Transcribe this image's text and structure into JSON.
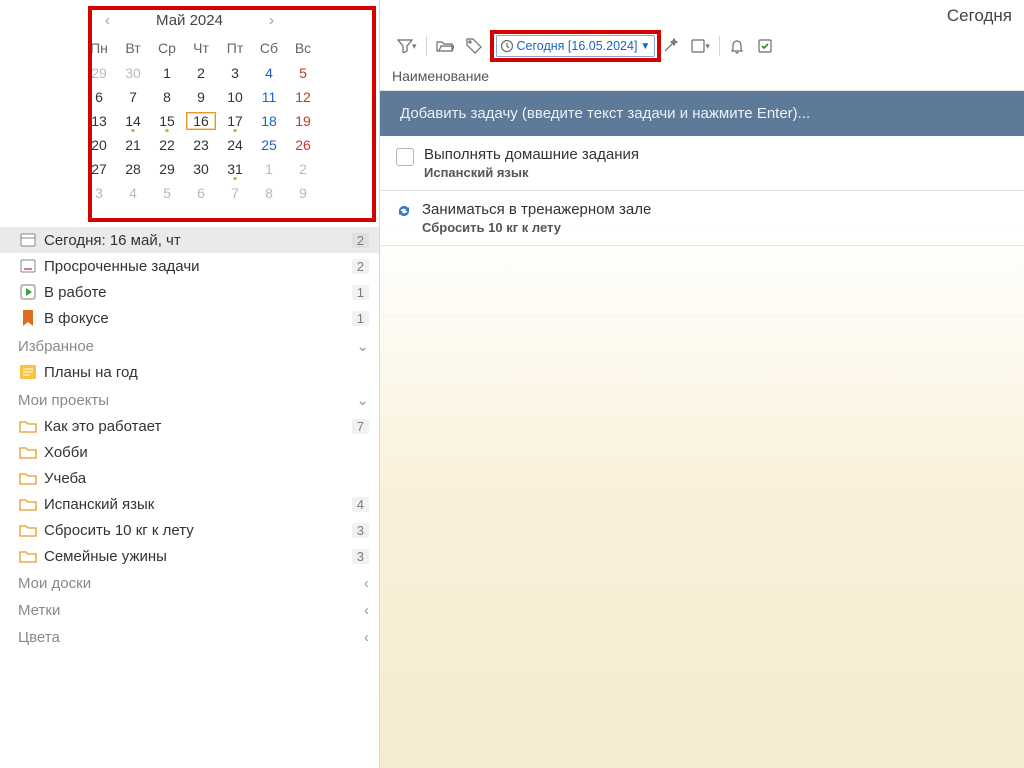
{
  "calendar": {
    "title": "Май 2024",
    "weekdays": [
      "Пн",
      "Вт",
      "Ср",
      "Чт",
      "Пт",
      "Сб",
      "Вс"
    ],
    "weeks": [
      [
        {
          "n": 29,
          "cls": "other"
        },
        {
          "n": 30,
          "cls": "other"
        },
        {
          "n": 1
        },
        {
          "n": 2
        },
        {
          "n": 3
        },
        {
          "n": 4,
          "cls": "sat"
        },
        {
          "n": 5,
          "cls": "sun"
        }
      ],
      [
        {
          "n": 6
        },
        {
          "n": 7
        },
        {
          "n": 8
        },
        {
          "n": 9
        },
        {
          "n": 10
        },
        {
          "n": 11,
          "cls": "sat"
        },
        {
          "n": 12,
          "cls": "sun"
        }
      ],
      [
        {
          "n": 13
        },
        {
          "n": 14,
          "dot": true
        },
        {
          "n": 15,
          "dot": true
        },
        {
          "n": 16,
          "today": true
        },
        {
          "n": 17,
          "dot": true
        },
        {
          "n": 18,
          "cls": "sat"
        },
        {
          "n": 19,
          "cls": "sun"
        }
      ],
      [
        {
          "n": 20
        },
        {
          "n": 21
        },
        {
          "n": 22
        },
        {
          "n": 23
        },
        {
          "n": 24
        },
        {
          "n": 25,
          "cls": "sat"
        },
        {
          "n": 26,
          "cls": "sun"
        }
      ],
      [
        {
          "n": 27
        },
        {
          "n": 28
        },
        {
          "n": 29
        },
        {
          "n": 30
        },
        {
          "n": 31,
          "dot": true
        },
        {
          "n": 1,
          "cls": "other"
        },
        {
          "n": 2,
          "cls": "other"
        }
      ],
      [
        {
          "n": 3,
          "cls": "other"
        },
        {
          "n": 4,
          "cls": "other"
        },
        {
          "n": 5,
          "cls": "other"
        },
        {
          "n": 6,
          "cls": "other"
        },
        {
          "n": 7,
          "cls": "other"
        },
        {
          "n": 8,
          "cls": "other"
        },
        {
          "n": 9,
          "cls": "other"
        }
      ]
    ]
  },
  "sidebar": {
    "today": {
      "label": "Сегодня: 16 май, чт",
      "count": "2"
    },
    "overdue": {
      "label": "Просроченные задачи",
      "count": "2"
    },
    "working": {
      "label": "В работе",
      "count": "1"
    },
    "focus": {
      "label": "В фокусе",
      "count": "1"
    },
    "sections": {
      "fav": "Избранное",
      "proj": "Мои проекты",
      "boards": "Мои доски",
      "tags": "Метки",
      "colors": "Цвета"
    },
    "fav_items": {
      "plans": {
        "label": "Планы на год"
      }
    },
    "projects": {
      "how": {
        "label": "Как это работает",
        "count": "7"
      },
      "hobby": {
        "label": "Хобби"
      },
      "study": {
        "label": "Учеба"
      },
      "spanish": {
        "label": "Испанский язык",
        "count": "4"
      },
      "weight": {
        "label": "Сбросить 10 кг к лету",
        "count": "3"
      },
      "dinner": {
        "label": "Семейные ужины",
        "count": "3"
      }
    }
  },
  "header": {
    "title": "Сегодня",
    "date_filter": "Сегодня [16.05.2024]",
    "column_title": "Наименование",
    "add_placeholder": "Добавить задачу (введите текст задачи и нажмите Enter)..."
  },
  "tasks": [
    {
      "title": "Выполнять домашние задания",
      "sub": "Испанский язык",
      "recurring": false
    },
    {
      "title": "Заниматься в тренажерном зале",
      "sub": "Сбросить 10 кг к лету",
      "recurring": true
    }
  ]
}
